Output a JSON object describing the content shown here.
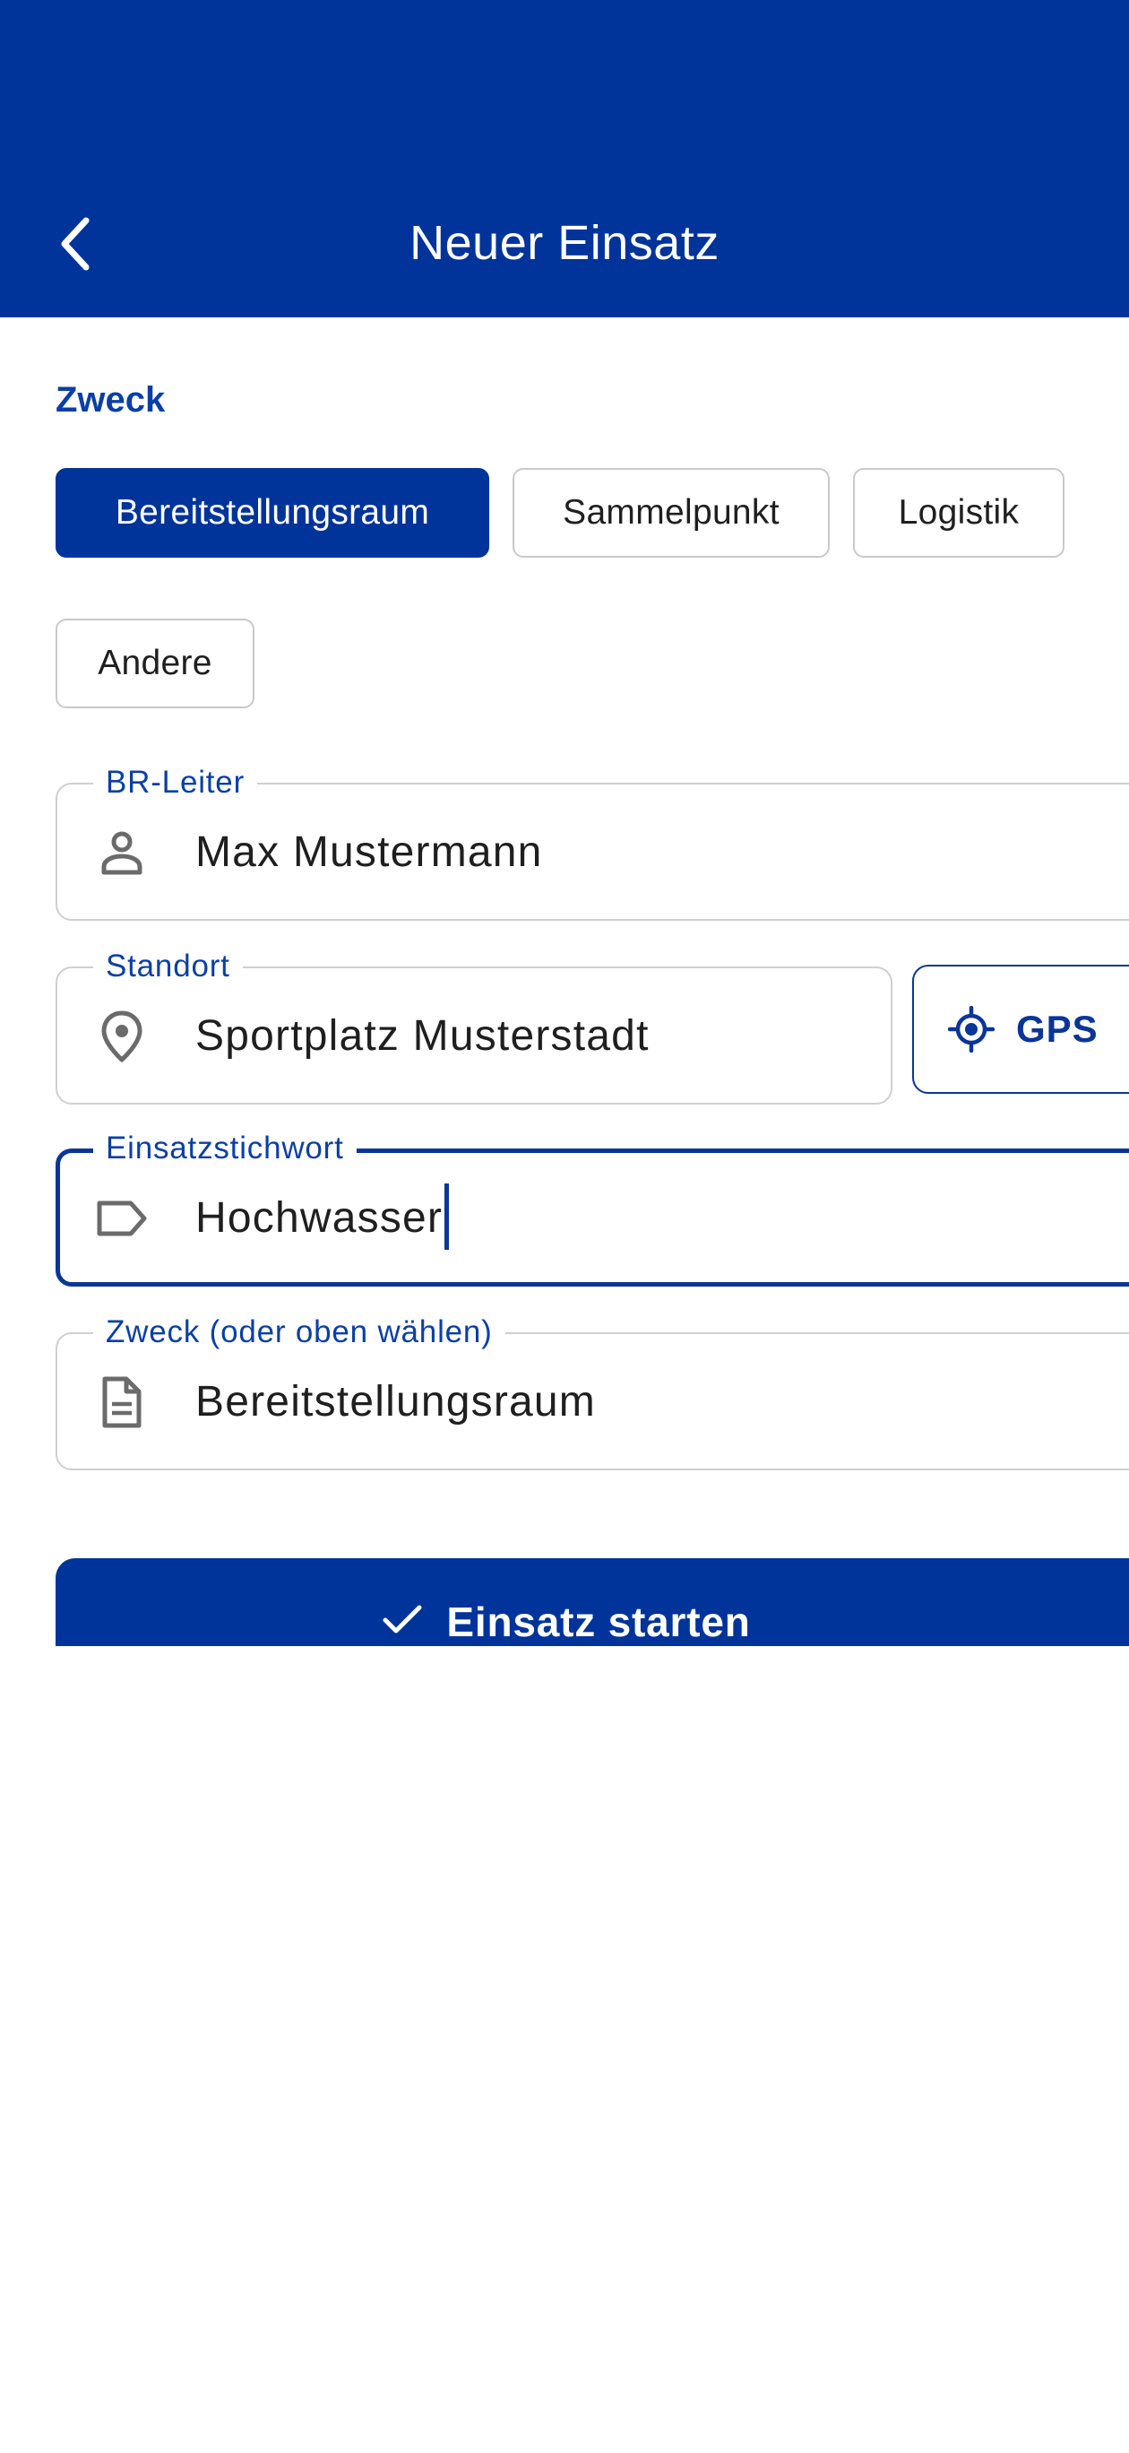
{
  "appbar": {
    "title": "Neuer Einsatz",
    "back_icon": "chevron-left-icon"
  },
  "purpose_section": {
    "label": "Zweck",
    "chips": [
      {
        "label": "Bereitstellungsraum",
        "selected": true
      },
      {
        "label": "Sammelpunkt",
        "selected": false
      },
      {
        "label": "Logistik",
        "selected": false
      },
      {
        "label": "Andere",
        "selected": false
      }
    ]
  },
  "fields": {
    "leader": {
      "label": "BR-Leiter",
      "value": "Max Mustermann",
      "icon": "person-icon"
    },
    "location": {
      "label": "Standort",
      "value": "Sportplatz Musterstadt",
      "icon": "location-pin-icon"
    },
    "keyword": {
      "label": "Einsatzstichwort",
      "value": "Hochwasser",
      "icon": "tag-icon",
      "focused": true
    },
    "purpose": {
      "label": "Zweck (oder oben wählen)",
      "value": "Bereitstellungsraum",
      "icon": "document-icon"
    }
  },
  "gps_button": {
    "label": "GPS",
    "icon": "crosshair-icon"
  },
  "start_button": {
    "label": "Einsatz starten",
    "icon": "check-icon"
  },
  "colors": {
    "primary": "#00349b",
    "accent_text": "#0a3fa8",
    "border": "#cfcfcf",
    "text": "#1f1f1f"
  }
}
